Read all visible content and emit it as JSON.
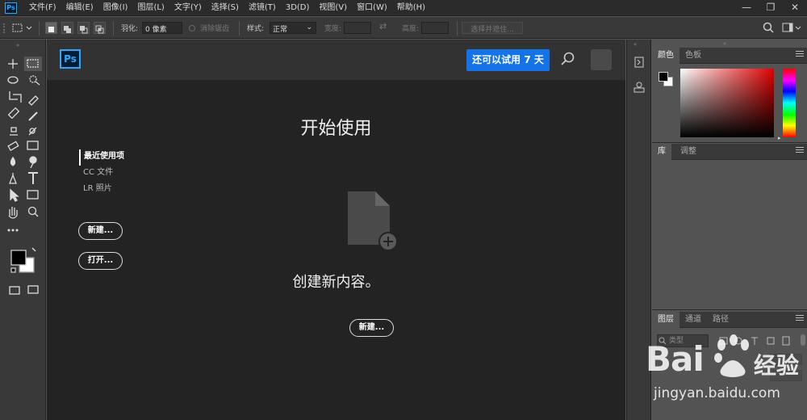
{
  "menubar": {
    "logo": "Ps",
    "items": [
      "文件(F)",
      "编辑(E)",
      "图像(I)",
      "图层(L)",
      "文字(Y)",
      "选择(S)",
      "滤镜(T)",
      "3D(D)",
      "视图(V)",
      "窗口(W)",
      "帮助(H)"
    ],
    "window_controls": {
      "minimize": "—",
      "restore": "❐",
      "close": "✕"
    }
  },
  "optbar": {
    "feather_label": "羽化:",
    "feather_value": "0 像素",
    "antialias_label": "消除锯齿",
    "style_label": "样式:",
    "style_value": "正常",
    "width_label": "宽度:",
    "height_label": "高度:",
    "select_mask_label": "选择并遮住..."
  },
  "home": {
    "logo": "Ps",
    "trial_button": "还可以试用 7 天",
    "title": "开始使用",
    "nav": [
      "最近使用项",
      "CC 文件",
      "LR 照片"
    ],
    "new_button": "新建...",
    "open_button": "打开...",
    "create_text": "创建新内容。",
    "create_button": "新建..."
  },
  "panels": {
    "color_tabs": [
      "颜色",
      "色板"
    ],
    "library_tabs": [
      "库",
      "调整"
    ],
    "layer_tabs": [
      "图层",
      "通道",
      "路径"
    ],
    "layer_search_placeholder": "类型"
  },
  "watermark": {
    "brand": "Bai",
    "brand_suffix": "经验",
    "url": "jingyan.baidu.com"
  },
  "colors": {
    "accent": "#1473e6",
    "ps_blue": "#31a8ff",
    "ps_dark": "#001d34"
  }
}
